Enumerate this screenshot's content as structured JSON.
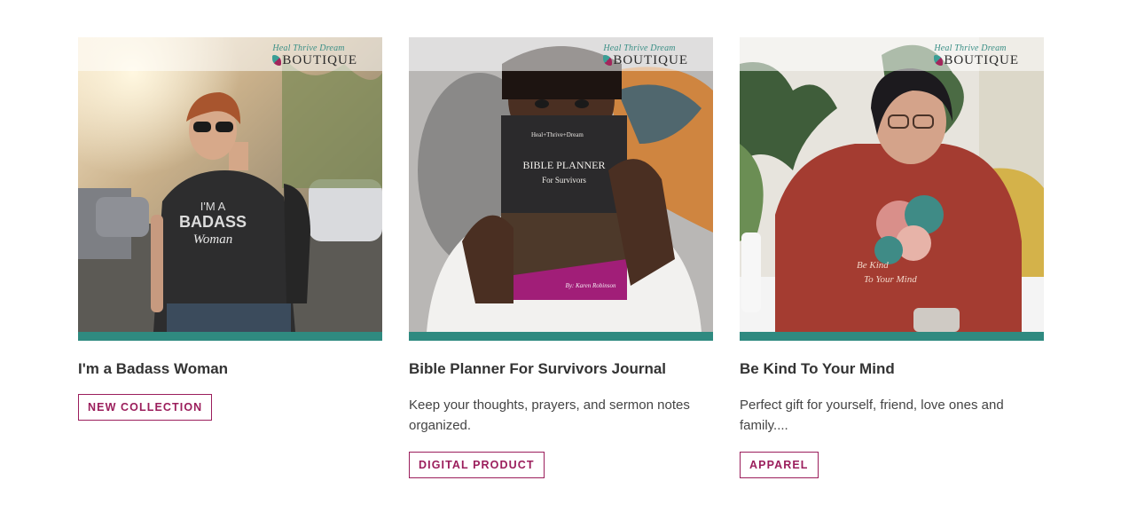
{
  "brand": {
    "script": "Heal Thrive Dream",
    "word": "BOUTIQUE"
  },
  "cards": [
    {
      "title": "I'm a Badass Woman",
      "description": "",
      "tag": "NEW COLLECTION",
      "shirt_text_1": "I'M A",
      "shirt_text_2": "BADASS",
      "shirt_text_3": "Woman"
    },
    {
      "title": "Bible Planner For Survivors Journal",
      "description": "Keep your thoughts, prayers, and sermon notes organized.",
      "tag": "DIGITAL PRODUCT",
      "book_brand": "Heal+Thrive+Dream",
      "book_title": "BIBLE PLANNER",
      "book_subtitle": "For Survivors",
      "book_author": "By: Karen Robinson"
    },
    {
      "title": "Be Kind To Your Mind",
      "description": "Perfect gift for yourself, friend, love ones and family....",
      "tag": "APPAREL",
      "hoodie_text_1": "Be Kind",
      "hoodie_text_2": "To Your Mind"
    }
  ],
  "colors": {
    "accent_bar": "#2f8a80",
    "tag_border": "#9b1e5c",
    "tag_text": "#9b1e5c"
  }
}
